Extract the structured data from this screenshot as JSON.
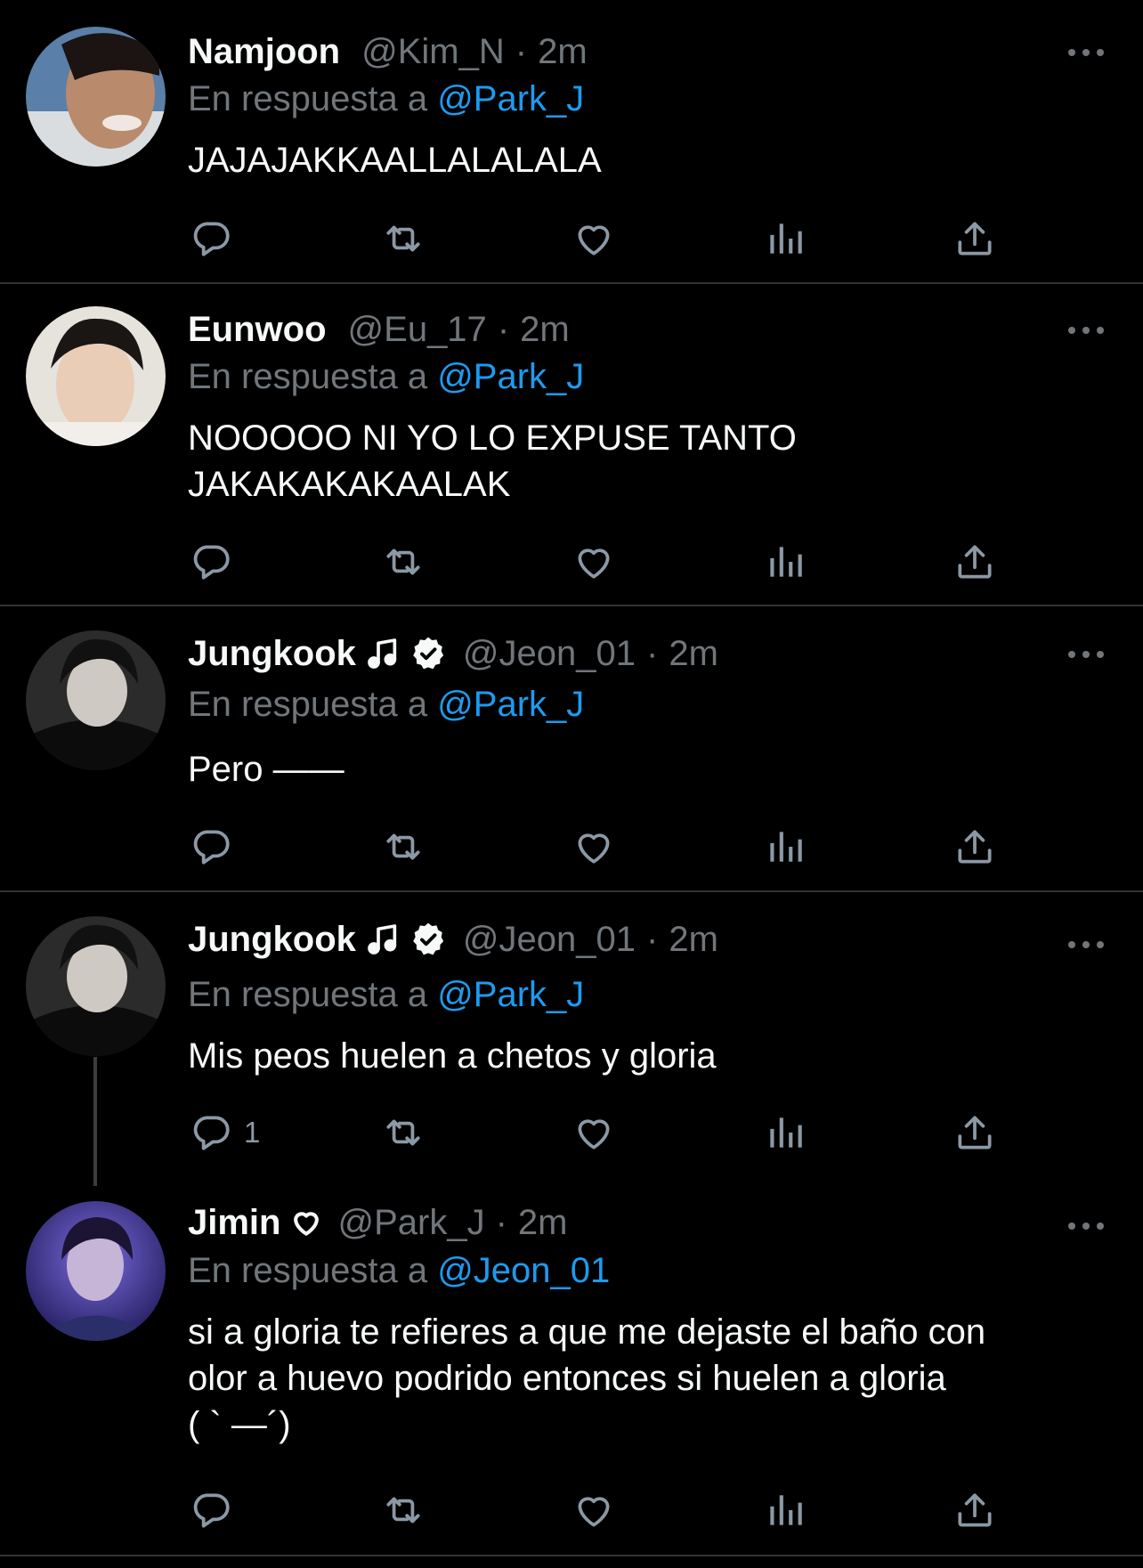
{
  "tweets": [
    {
      "name": "Namjoon",
      "handle": "@Kim_N",
      "sep": "·",
      "time": "2m",
      "reply_prefix": "En respuesta a",
      "reply_to": "@Park_J",
      "text_lines": [
        "JAJAJAKKAALLALALALA"
      ],
      "reply_count": ""
    },
    {
      "name": "Eunwoo",
      "handle": "@Eu_17",
      "sep": "·",
      "time": "2m",
      "reply_prefix": "En respuesta a",
      "reply_to": "@Park_J",
      "text_lines": [
        "NOOOOO NI YO LO EXPUSE TANTO",
        "JAKAKAKAKAALAK"
      ],
      "reply_count": ""
    },
    {
      "name": "Jungkook",
      "name_badges": [
        "music-note-icon",
        "verified-badge-icon"
      ],
      "handle": "@Jeon_01",
      "sep": "·",
      "time": "2m",
      "reply_prefix": "En respuesta a",
      "reply_to": "@Park_J",
      "text_lines": [
        "Pero ——"
      ],
      "reply_count": ""
    },
    {
      "name": "Jungkook",
      "name_badges": [
        "music-note-icon",
        "verified-badge-icon"
      ],
      "handle": "@Jeon_01",
      "sep": "·",
      "time": "2m",
      "reply_prefix": "En respuesta a",
      "reply_to": "@Park_J",
      "text_lines": [
        "Mis peos huelen a chetos y gloria"
      ],
      "reply_count": "1"
    },
    {
      "name": "Jimin",
      "name_badges": [
        "heart-outline-icon"
      ],
      "handle": "@Park_J",
      "sep": "·",
      "time": "2m",
      "reply_prefix": "En respuesta a",
      "reply_to": "@Jeon_01",
      "text_lines": [
        "si a gloria te refieres a que me dejaste el baño con",
        "olor a huevo podrido entonces si huelen a gloria",
        "( ` —´)"
      ],
      "reply_count": ""
    }
  ],
  "action_icons": [
    "reply-icon",
    "retweet-icon",
    "like-icon",
    "views-icon",
    "share-icon"
  ],
  "colors": {
    "background": "#000000",
    "text": "#f7f9f9",
    "muted": "#71767b",
    "mention": "#1d9bf0",
    "divider": "#2f3336"
  }
}
